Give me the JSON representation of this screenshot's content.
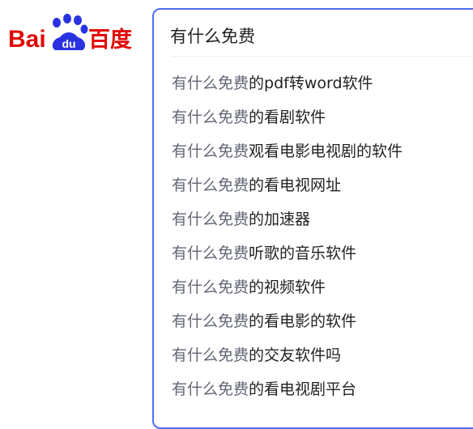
{
  "logo": {
    "text_left": "Bai",
    "text_paw": "du",
    "text_right": "百度",
    "colors": {
      "red": "#e10602",
      "blue": "#2932e1"
    }
  },
  "search": {
    "value": "有什么免费",
    "border_color": "#4e6ef2"
  },
  "suggestions": [
    {
      "prefix": "有什么免费",
      "suffix": "的pdf转word软件"
    },
    {
      "prefix": "有什么免费",
      "suffix": "的看剧软件"
    },
    {
      "prefix": "有什么免费",
      "suffix": "观看电影电视剧的软件"
    },
    {
      "prefix": "有什么免费",
      "suffix": "的看电视网址"
    },
    {
      "prefix": "有什么免费",
      "suffix": "的加速器"
    },
    {
      "prefix": "有什么免费",
      "suffix": "听歌的音乐软件"
    },
    {
      "prefix": "有什么免费",
      "suffix": "的视频软件"
    },
    {
      "prefix": "有什么免费",
      "suffix": "的看电影的软件"
    },
    {
      "prefix": "有什么免费",
      "suffix": "的交友软件吗"
    },
    {
      "prefix": "有什么免费",
      "suffix": "的看电视剧平台"
    }
  ]
}
